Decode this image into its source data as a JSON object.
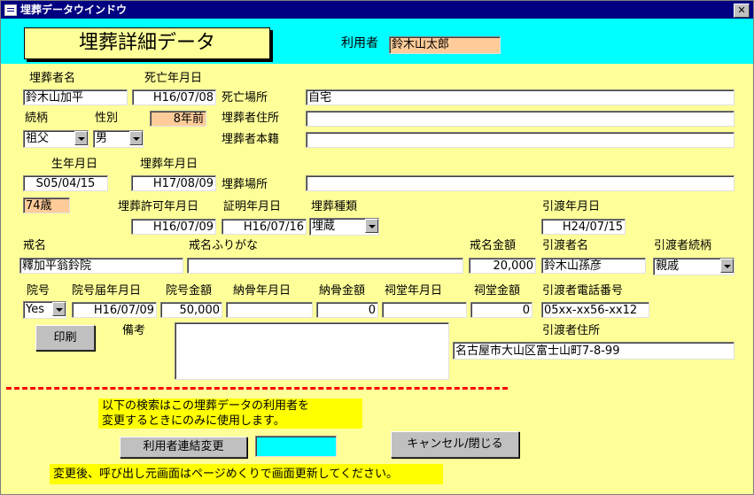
{
  "window": {
    "title": "埋葬データウインドウ",
    "close_glyph": "✕"
  },
  "header": {
    "form_title": "埋葬詳細データ",
    "user_label": "利用者",
    "user_value": "鈴木山太郎"
  },
  "labels": {
    "deceased_name": "埋葬者名",
    "death_date": "死亡年月日",
    "death_place": "死亡場所",
    "relation": "続柄",
    "sex": "性別",
    "address": "埋葬者住所",
    "domicile": "埋葬者本籍",
    "birth_date": "生年月日",
    "burial_date": "埋葬年月日",
    "burial_place": "埋葬場所",
    "permit_date": "埋葬許可年月日",
    "cert_date": "証明年月日",
    "burial_type": "埋葬種類",
    "handover_date": "引渡年月日",
    "kaimyo": "戒名",
    "kaimyo_kana": "戒名ふりがな",
    "kaimyo_fee": "戒名金額",
    "recipient": "引渡者名",
    "recipient_relation": "引渡者続柄",
    "ingo": "院号",
    "ingo_date": "院号届年月日",
    "ingo_fee": "院号金額",
    "nokotsu_date": "納骨年月日",
    "nokotsu_fee": "納骨金額",
    "shido_date": "祠堂年月日",
    "shido_fee": "祠堂金額",
    "recipient_phone": "引渡者電話番号",
    "remarks": "備考",
    "recipient_address": "引渡者住所"
  },
  "values": {
    "deceased_name": "鈴木山加平",
    "death_date": "H16/07/08",
    "death_place": "自宅",
    "years_since": "8年前",
    "relation": "祖父",
    "sex": "男",
    "address": "",
    "domicile": "",
    "birth_date": "S05/04/15",
    "burial_date": "H17/08/09",
    "burial_place": "",
    "age": "74歳",
    "permit_date": "H16/07/09",
    "cert_date": "H16/07/16",
    "burial_type": "埋蔵",
    "handover_date": "H24/07/15",
    "kaimyo": "釋加平翁鈴院",
    "kaimyo_kana": "",
    "kaimyo_fee": "20,000",
    "recipient": "鈴木山孫彦",
    "recipient_relation": "親戚",
    "ingo": "Yes",
    "ingo_date": "H16/07/09",
    "ingo_fee": "50,000",
    "nokotsu_date": "",
    "nokotsu_fee": "0",
    "shido_date": "",
    "shido_fee": "0",
    "recipient_phone": "05xx-xx56-xx12",
    "remarks": "",
    "recipient_address": "名古屋市大山区富士山町7-8-99"
  },
  "buttons": {
    "print": "印刷",
    "change_link": "利用者連結変更",
    "cancel_close": "キャンセル/閉じる"
  },
  "search": {
    "value": ""
  },
  "notes": {
    "search_line1": "以下の検索はこの埋葬データの利用者を",
    "search_line2": "変更するときにのみに使用します。",
    "after_change": "変更後、呼び出し元画面はページめくりで画面更新してください。"
  },
  "colors": {
    "form_bg": "#ffff99",
    "header_bg": "#00ffff",
    "highlight": "#ffcc99",
    "note_bg": "#ffff00",
    "separator": "#ff0000"
  }
}
